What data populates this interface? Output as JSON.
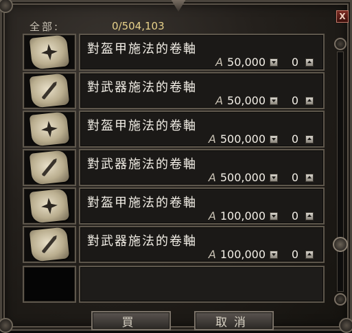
{
  "header": {
    "money_label": "全部:",
    "money_value": "0/504,103"
  },
  "close_label": "X",
  "items": [
    {
      "name": "對盔甲施法的卷軸",
      "currency": "A",
      "price": "50,000",
      "qty": "0",
      "icon": "armor-scroll-icon"
    },
    {
      "name": "對武器施法的卷軸",
      "currency": "A",
      "price": "50,000",
      "qty": "0",
      "icon": "weapon-scroll-icon"
    },
    {
      "name": "對盔甲施法的卷軸",
      "currency": "A",
      "price": "500,000",
      "qty": "0",
      "icon": "armor-scroll-icon"
    },
    {
      "name": "對武器施法的卷軸",
      "currency": "A",
      "price": "500,000",
      "qty": "0",
      "icon": "weapon-scroll-icon"
    },
    {
      "name": "對盔甲施法的卷軸",
      "currency": "A",
      "price": "100,000",
      "qty": "0",
      "icon": "armor-scroll-icon"
    },
    {
      "name": "對武器施法的卷軸",
      "currency": "A",
      "price": "100,000",
      "qty": "0",
      "icon": "weapon-scroll-icon"
    }
  ],
  "buttons": {
    "buy": "買",
    "cancel": "取消"
  },
  "colors": {
    "money_value": "#e8d28a",
    "item_text": "#f2eee6",
    "frame": "#5e574c"
  }
}
